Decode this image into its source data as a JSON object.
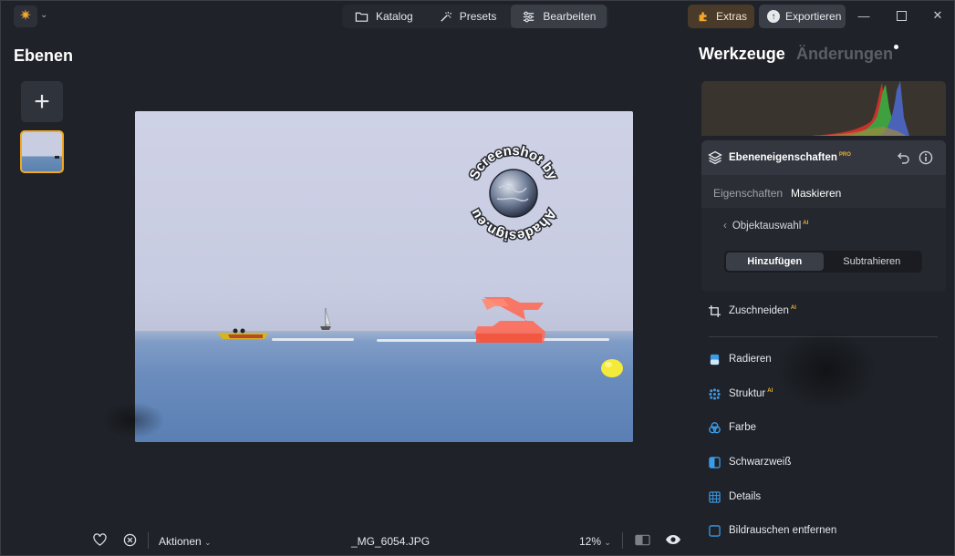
{
  "titlebar": {
    "nav": [
      {
        "label": "Katalog",
        "icon": "folder-icon",
        "active": false
      },
      {
        "label": "Presets",
        "icon": "magic-wand-icon",
        "active": false
      },
      {
        "label": "Bearbeiten",
        "icon": "sliders-icon",
        "active": true
      }
    ],
    "extras_label": "Extras",
    "export_label": "Exportieren",
    "accent": "#f0a825"
  },
  "left_panel": {
    "title": "Ebenen"
  },
  "photo": {
    "watermark": "Screenshot by Ahadesign.eu"
  },
  "bottombar": {
    "actions_label": "Aktionen",
    "filename": "_MG_6054.JPG",
    "zoom": "12%"
  },
  "right_panel": {
    "tab_tools": "Werkzeuge",
    "tab_changes": "Änderungen",
    "props": {
      "title": "Ebeneneigenschaften",
      "badge": "PRO",
      "subtab_properties": "Eigenschaften",
      "subtab_masking": "Maskieren",
      "object_selection": "Objektauswahl",
      "object_selection_badge": "AI",
      "add_label": "Hinzufügen",
      "subtract_label": "Subtrahieren"
    },
    "crop": {
      "label": "Zuschneiden",
      "badge": "AI"
    },
    "tools": [
      {
        "label": "Radieren",
        "icon": "eraser-icon",
        "badge": ""
      },
      {
        "label": "Struktur",
        "icon": "structure-icon",
        "badge": "AI"
      },
      {
        "label": "Farbe",
        "icon": "color-icon",
        "badge": ""
      },
      {
        "label": "Schwarzweiß",
        "icon": "black-white-icon",
        "badge": ""
      },
      {
        "label": "Details",
        "icon": "details-icon",
        "badge": ""
      },
      {
        "label": "Bildrauschen entfernen",
        "icon": "denoise-icon",
        "badge": ""
      }
    ]
  }
}
